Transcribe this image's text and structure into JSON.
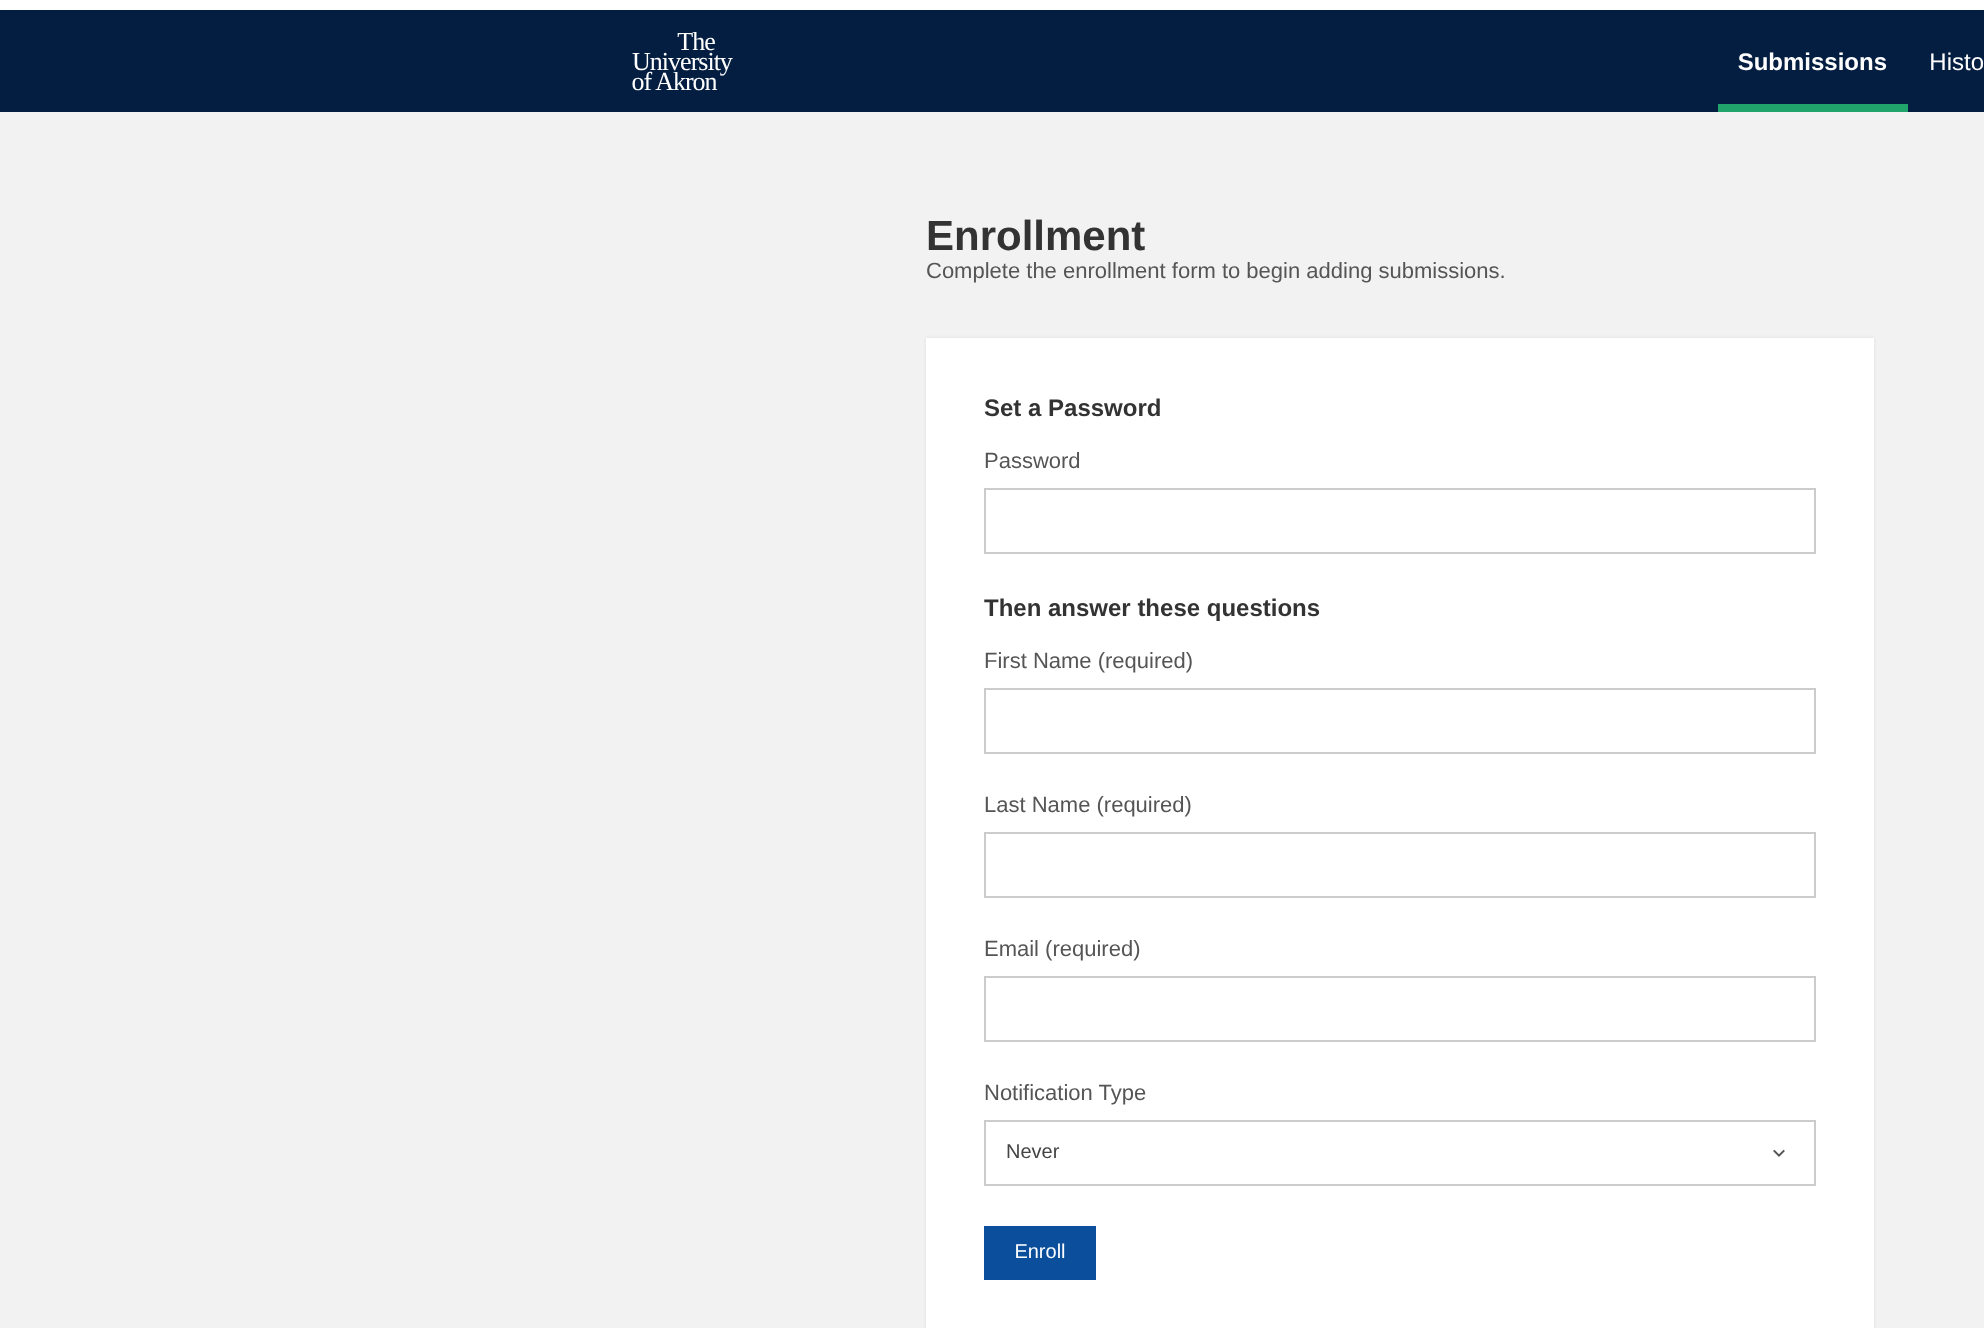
{
  "logo": {
    "lines": [
      "The",
      "University",
      "of Akron"
    ]
  },
  "nav": {
    "tabs": [
      {
        "label": "Submissions",
        "selected": true
      },
      {
        "label": "Histo",
        "selected": false
      }
    ]
  },
  "page": {
    "title": "Enrollment",
    "subtitle": "Complete the enrollment form to begin adding submissions."
  },
  "form": {
    "sections": [
      {
        "heading": "Set a Password",
        "fields": [
          {
            "kind": "text",
            "label": "Password"
          }
        ]
      },
      {
        "heading": "Then answer these questions",
        "fields": [
          {
            "kind": "text",
            "label": "First Name (required)"
          },
          {
            "kind": "text",
            "label": "Last Name (required)"
          },
          {
            "kind": "text",
            "label": "Email (required)"
          },
          {
            "kind": "select",
            "label": "Notification Type",
            "value": "Never"
          }
        ]
      }
    ],
    "submit": "Enroll"
  }
}
